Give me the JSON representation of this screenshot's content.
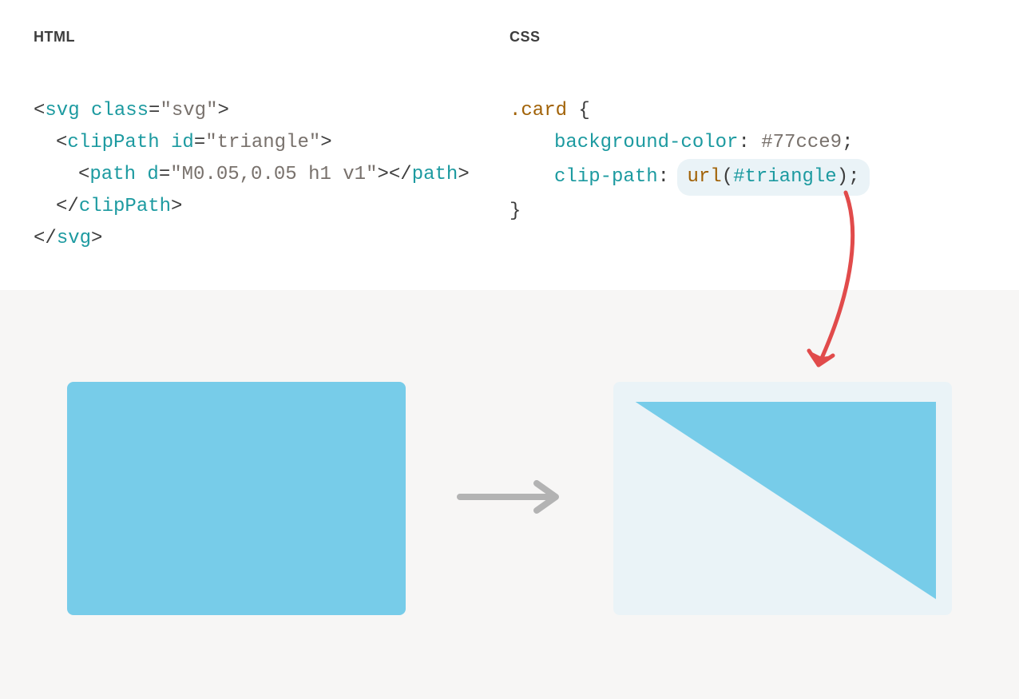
{
  "headings": {
    "html": "HTML",
    "css": "CSS"
  },
  "html_code": {
    "line1": {
      "tag": "svg",
      "attr": "class",
      "val": "\"svg\""
    },
    "line2": {
      "tag": "clipPath",
      "attr": "id",
      "val": "\"triangle\""
    },
    "line3": {
      "tag": "path",
      "attr": "d",
      "val": "\"M0.05,0.05 h1 v1\"",
      "close": "path"
    },
    "line4": {
      "tag": "clipPath"
    },
    "line5": {
      "tag": "svg"
    }
  },
  "css_code": {
    "selector": ".card",
    "open": "{",
    "prop1": "background-color",
    "val1": "#77cce9",
    "prop2": "clip-path",
    "fn": "url",
    "arg": "#triangle",
    "close": "}",
    "colon": ":",
    "semicolon": ";"
  },
  "colors": {
    "card": "#77cce9",
    "highlight": "#eaf3f7",
    "arrow_red": "#e14b4b",
    "arrow_gray": "#b3b3b3"
  }
}
